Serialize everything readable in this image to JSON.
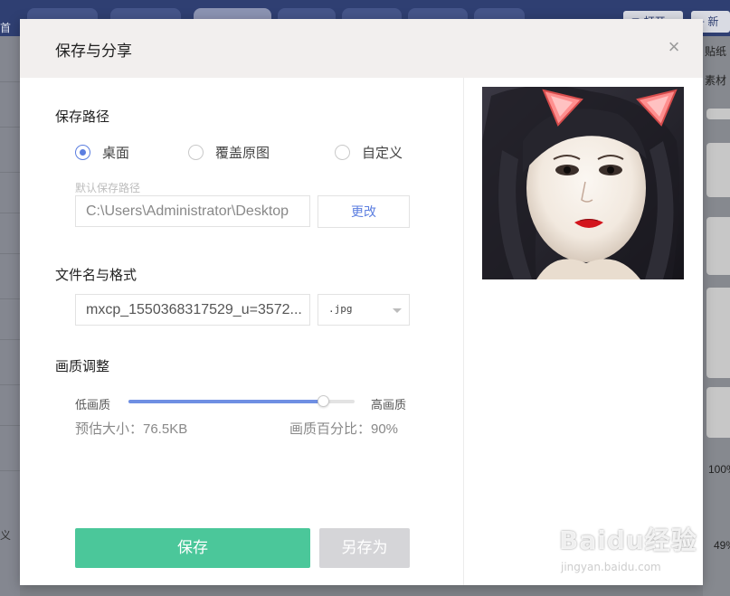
{
  "background_app": {
    "top_button_1": "打开",
    "top_button_2": "新",
    "right_panel": {
      "sticker_label": "贴纸",
      "material_label": "素材",
      "zoom_1": "100%",
      "zoom_2": "49%"
    },
    "left_panel": {
      "label_1": "首",
      "label_2": "义"
    }
  },
  "dialog": {
    "title": "保存与分享",
    "close_glyph": "×",
    "save_path": {
      "section_title": "保存路径",
      "options": [
        {
          "label": "桌面",
          "checked": true
        },
        {
          "label": "覆盖原图",
          "checked": false
        },
        {
          "label": "自定义",
          "checked": false
        }
      ],
      "default_path_label": "默认保存路径",
      "path_value": "C:\\Users\\Administrator\\Desktop",
      "change_button": "更改"
    },
    "file": {
      "section_title": "文件名与格式",
      "filename": "mxcp_1550368317529_u=3572...",
      "format": ".jpg"
    },
    "quality": {
      "section_title": "画质调整",
      "low_label": "低画质",
      "high_label": "高画质",
      "value_fraction": 0.86,
      "estimated_size": "预估大小：76.5KB",
      "percent_text": "画质百分比：90%"
    },
    "buttons": {
      "save": "保存",
      "save_as": "另存为"
    }
  },
  "watermark": {
    "brand": "Baidu经验",
    "url": "jingyan.baidu.com"
  },
  "colors": {
    "accent": "#5b7ee0",
    "save_button": "#4bc79a",
    "disabled_button": "#d5d5d8",
    "header_bg": "#f2efee"
  }
}
